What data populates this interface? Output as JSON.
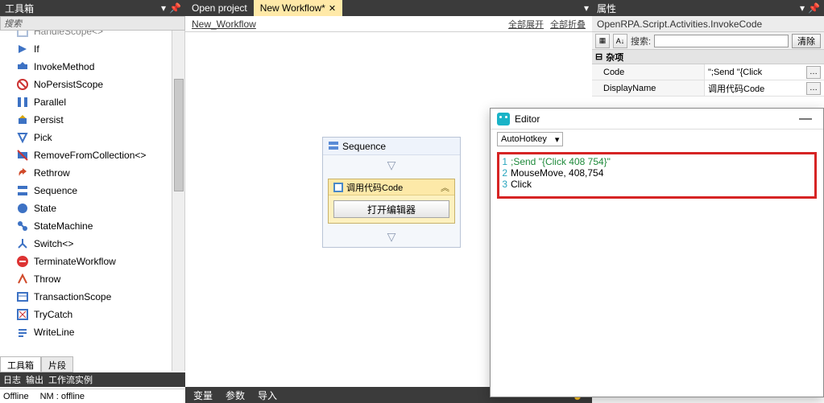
{
  "left": {
    "title": "工具箱",
    "search_placeholder": "搜索",
    "items": [
      {
        "label": "HandleScope<>"
      },
      {
        "label": "If"
      },
      {
        "label": "InvokeMethod"
      },
      {
        "label": "NoPersistScope"
      },
      {
        "label": "Parallel"
      },
      {
        "label": "Persist"
      },
      {
        "label": "Pick"
      },
      {
        "label": "RemoveFromCollection<>"
      },
      {
        "label": "Rethrow"
      },
      {
        "label": "Sequence"
      },
      {
        "label": "State"
      },
      {
        "label": "StateMachine"
      },
      {
        "label": "Switch<>"
      },
      {
        "label": "TerminateWorkflow"
      },
      {
        "label": "Throw"
      },
      {
        "label": "TransactionScope"
      },
      {
        "label": "TryCatch"
      },
      {
        "label": "WriteLine"
      }
    ],
    "tab_toolbox": "工具箱",
    "tab_snippets": "片段",
    "logs": {
      "a": "日志",
      "b": "输出",
      "c": "工作流实例"
    },
    "status_offline": "Offline",
    "status_nm": "NM : offline"
  },
  "mid": {
    "tab_open": "Open project",
    "tab_active": "New Workflow*",
    "breadcrumb": "New_Workflow",
    "expand_all": "全部展开",
    "collapse_all": "全部折叠",
    "sequence_label": "Sequence",
    "invoke_label": "调用代码Code",
    "open_editor_btn": "打开编辑器",
    "footer_vars": "变量",
    "footer_args": "参数",
    "footer_import": "导入"
  },
  "right": {
    "title": "属性",
    "class_name": "OpenRPA.Script.Activities.InvokeCode",
    "search_label": "搜索:",
    "clear_btn": "清除",
    "category": "杂项",
    "rows": [
      {
        "name": "Code",
        "value": "\";Send \"{Click"
      },
      {
        "name": "DisplayName",
        "value": "调用代码Code"
      }
    ]
  },
  "editor": {
    "title": "Editor",
    "language": "AutoHotkey",
    "code": [
      {
        "n": "1",
        "text": ";Send \"{Click 408 754}\"",
        "cls": "comment"
      },
      {
        "n": "2",
        "text": "MouseMove, 408,754",
        "cls": ""
      },
      {
        "n": "3",
        "text": "Click",
        "cls": ""
      }
    ]
  }
}
